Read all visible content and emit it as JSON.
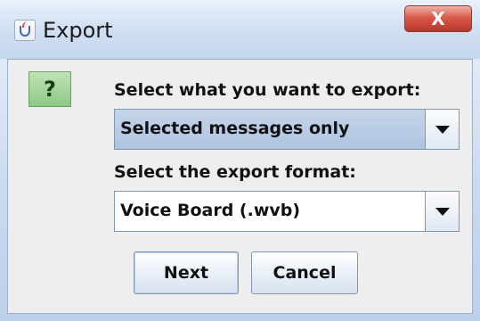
{
  "window": {
    "title": "Export",
    "title_icon": "java-cup-icon",
    "close_label": "X"
  },
  "dialog": {
    "help_icon_glyph": "?",
    "export_what_label": "Select what you want to export:",
    "export_what_value": "Selected messages only",
    "export_format_label": "Select the export format:",
    "export_format_value": "Voice Board (.wvb)"
  },
  "buttons": {
    "next": "Next",
    "cancel": "Cancel"
  },
  "colors": {
    "titlebar": "#d2e1f3",
    "close_button": "#d8594a",
    "help_icon": "#8cc985",
    "selected_combo": "#aec3df"
  }
}
